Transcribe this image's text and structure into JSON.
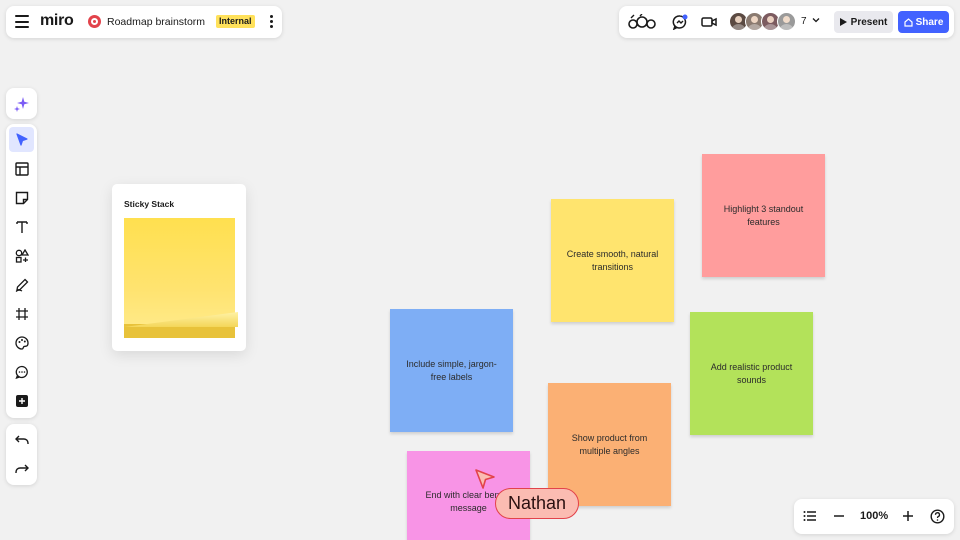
{
  "header": {
    "app_name": "miro",
    "board_title": "Roadmap brainstorm",
    "badge": "Internal",
    "menu_icon": "hamburger-icon",
    "more_icon": "kebab-icon"
  },
  "collab": {
    "collaborator_count": "7",
    "present_label": "Present",
    "share_label": "Share",
    "avatar_colors": [
      "#5b4a42",
      "#8a7a70",
      "#7c5b60",
      "#9a9a9a"
    ]
  },
  "toolbar": {
    "tools": [
      {
        "name": "select-tool",
        "icon": "arrow-cursor-icon"
      },
      {
        "name": "templates-tool",
        "icon": "layout-icon"
      },
      {
        "name": "sticky-note-tool",
        "icon": "sticky-note-icon"
      },
      {
        "name": "text-tool",
        "icon": "text-icon"
      },
      {
        "name": "shapes-tool",
        "icon": "shapes-icon"
      },
      {
        "name": "pen-tool",
        "icon": "pen-icon"
      },
      {
        "name": "frame-tool",
        "icon": "frame-icon"
      },
      {
        "name": "reactions-tool",
        "icon": "palette-icon"
      },
      {
        "name": "comment-tool",
        "icon": "comment-icon"
      },
      {
        "name": "more-tools",
        "icon": "plus-icon"
      }
    ],
    "history": [
      "undo-icon",
      "redo-icon"
    ]
  },
  "sticky_stack": {
    "title": "Sticky Stack",
    "color": "#ffe04f"
  },
  "notes": [
    {
      "text": "Highlight 3 standout features",
      "color": "#ff9d9d"
    },
    {
      "text": "Create smooth, natural transitions",
      "color": "#ffe46e"
    },
    {
      "text": "Include simple, jargon-free labels",
      "color": "#7eaef5"
    },
    {
      "text": "Add realistic product sounds",
      "color": "#b3e25a"
    },
    {
      "text": "Show product from multiple angles",
      "color": "#fbb074"
    },
    {
      "text": "End with clear benefit message",
      "color": "#f894e6"
    }
  ],
  "cursor": {
    "user": "Nathan",
    "color": "#e2434b"
  },
  "zoom": {
    "level": "100%"
  }
}
